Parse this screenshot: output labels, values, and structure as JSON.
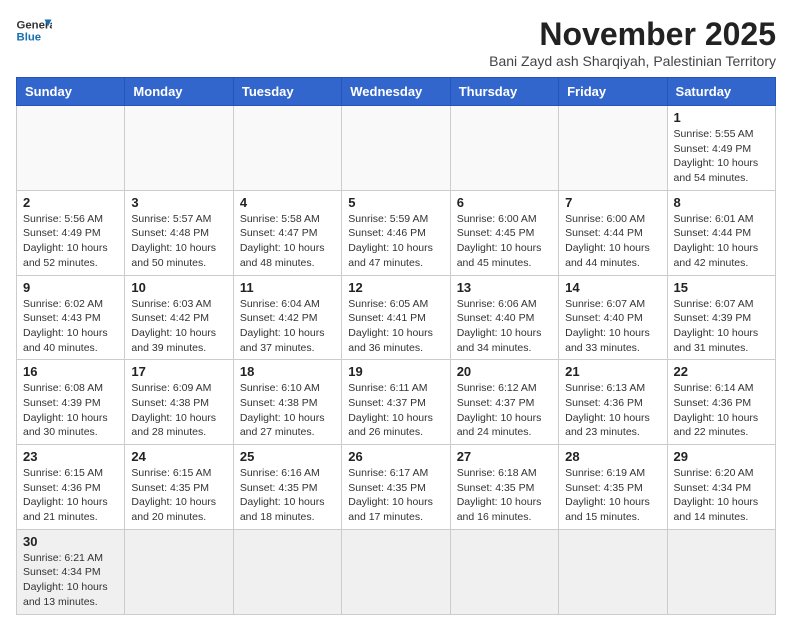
{
  "header": {
    "logo_general": "General",
    "logo_blue": "Blue",
    "month_title": "November 2025",
    "subtitle": "Bani Zayd ash Sharqiyah, Palestinian Territory"
  },
  "weekdays": [
    "Sunday",
    "Monday",
    "Tuesday",
    "Wednesday",
    "Thursday",
    "Friday",
    "Saturday"
  ],
  "days": [
    {
      "num": "",
      "info": ""
    },
    {
      "num": "",
      "info": ""
    },
    {
      "num": "",
      "info": ""
    },
    {
      "num": "",
      "info": ""
    },
    {
      "num": "",
      "info": ""
    },
    {
      "num": "",
      "info": ""
    },
    {
      "num": "1",
      "info": "Sunrise: 5:55 AM\nSunset: 4:49 PM\nDaylight: 10 hours and 54 minutes."
    },
    {
      "num": "2",
      "info": "Sunrise: 5:56 AM\nSunset: 4:49 PM\nDaylight: 10 hours and 52 minutes."
    },
    {
      "num": "3",
      "info": "Sunrise: 5:57 AM\nSunset: 4:48 PM\nDaylight: 10 hours and 50 minutes."
    },
    {
      "num": "4",
      "info": "Sunrise: 5:58 AM\nSunset: 4:47 PM\nDaylight: 10 hours and 48 minutes."
    },
    {
      "num": "5",
      "info": "Sunrise: 5:59 AM\nSunset: 4:46 PM\nDaylight: 10 hours and 47 minutes."
    },
    {
      "num": "6",
      "info": "Sunrise: 6:00 AM\nSunset: 4:45 PM\nDaylight: 10 hours and 45 minutes."
    },
    {
      "num": "7",
      "info": "Sunrise: 6:00 AM\nSunset: 4:44 PM\nDaylight: 10 hours and 44 minutes."
    },
    {
      "num": "8",
      "info": "Sunrise: 6:01 AM\nSunset: 4:44 PM\nDaylight: 10 hours and 42 minutes."
    },
    {
      "num": "9",
      "info": "Sunrise: 6:02 AM\nSunset: 4:43 PM\nDaylight: 10 hours and 40 minutes."
    },
    {
      "num": "10",
      "info": "Sunrise: 6:03 AM\nSunset: 4:42 PM\nDaylight: 10 hours and 39 minutes."
    },
    {
      "num": "11",
      "info": "Sunrise: 6:04 AM\nSunset: 4:42 PM\nDaylight: 10 hours and 37 minutes."
    },
    {
      "num": "12",
      "info": "Sunrise: 6:05 AM\nSunset: 4:41 PM\nDaylight: 10 hours and 36 minutes."
    },
    {
      "num": "13",
      "info": "Sunrise: 6:06 AM\nSunset: 4:40 PM\nDaylight: 10 hours and 34 minutes."
    },
    {
      "num": "14",
      "info": "Sunrise: 6:07 AM\nSunset: 4:40 PM\nDaylight: 10 hours and 33 minutes."
    },
    {
      "num": "15",
      "info": "Sunrise: 6:07 AM\nSunset: 4:39 PM\nDaylight: 10 hours and 31 minutes."
    },
    {
      "num": "16",
      "info": "Sunrise: 6:08 AM\nSunset: 4:39 PM\nDaylight: 10 hours and 30 minutes."
    },
    {
      "num": "17",
      "info": "Sunrise: 6:09 AM\nSunset: 4:38 PM\nDaylight: 10 hours and 28 minutes."
    },
    {
      "num": "18",
      "info": "Sunrise: 6:10 AM\nSunset: 4:38 PM\nDaylight: 10 hours and 27 minutes."
    },
    {
      "num": "19",
      "info": "Sunrise: 6:11 AM\nSunset: 4:37 PM\nDaylight: 10 hours and 26 minutes."
    },
    {
      "num": "20",
      "info": "Sunrise: 6:12 AM\nSunset: 4:37 PM\nDaylight: 10 hours and 24 minutes."
    },
    {
      "num": "21",
      "info": "Sunrise: 6:13 AM\nSunset: 4:36 PM\nDaylight: 10 hours and 23 minutes."
    },
    {
      "num": "22",
      "info": "Sunrise: 6:14 AM\nSunset: 4:36 PM\nDaylight: 10 hours and 22 minutes."
    },
    {
      "num": "23",
      "info": "Sunrise: 6:15 AM\nSunset: 4:36 PM\nDaylight: 10 hours and 21 minutes."
    },
    {
      "num": "24",
      "info": "Sunrise: 6:15 AM\nSunset: 4:35 PM\nDaylight: 10 hours and 20 minutes."
    },
    {
      "num": "25",
      "info": "Sunrise: 6:16 AM\nSunset: 4:35 PM\nDaylight: 10 hours and 18 minutes."
    },
    {
      "num": "26",
      "info": "Sunrise: 6:17 AM\nSunset: 4:35 PM\nDaylight: 10 hours and 17 minutes."
    },
    {
      "num": "27",
      "info": "Sunrise: 6:18 AM\nSunset: 4:35 PM\nDaylight: 10 hours and 16 minutes."
    },
    {
      "num": "28",
      "info": "Sunrise: 6:19 AM\nSunset: 4:35 PM\nDaylight: 10 hours and 15 minutes."
    },
    {
      "num": "29",
      "info": "Sunrise: 6:20 AM\nSunset: 4:34 PM\nDaylight: 10 hours and 14 minutes."
    },
    {
      "num": "30",
      "info": "Sunrise: 6:21 AM\nSunset: 4:34 PM\nDaylight: 10 hours and 13 minutes."
    },
    {
      "num": "",
      "info": ""
    },
    {
      "num": "",
      "info": ""
    },
    {
      "num": "",
      "info": ""
    },
    {
      "num": "",
      "info": ""
    },
    {
      "num": "",
      "info": ""
    },
    {
      "num": "",
      "info": ""
    }
  ]
}
